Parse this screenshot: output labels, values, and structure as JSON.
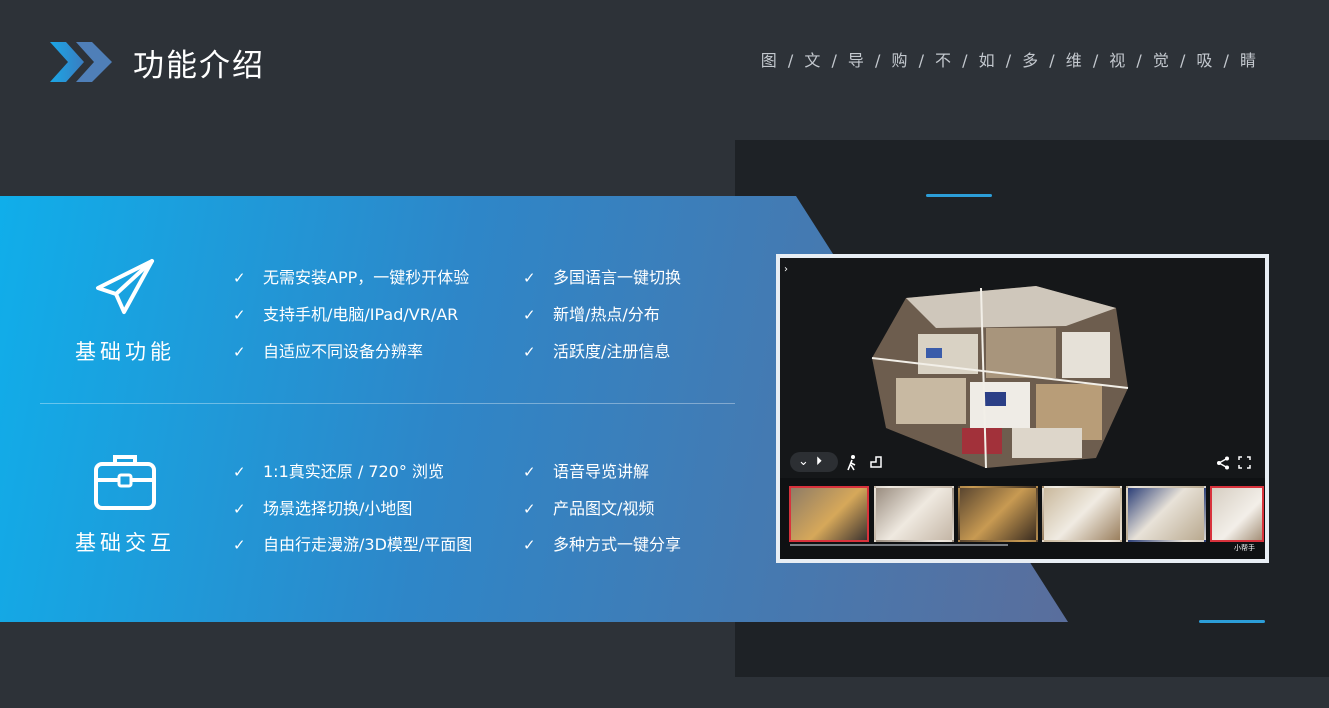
{
  "header": {
    "title": "功能介绍",
    "slogan": "图 / 文 / 导 / 购 / 不 / 如 / 多 / 维 / 视 / 觉 / 吸 / 睛"
  },
  "sections": [
    {
      "label": "基础功能",
      "icon": "paper-plane-icon",
      "features": [
        "无需安装APP，一键秒开体验",
        "支持手机/电脑/IPad/VR/AR",
        "自适应不同设备分辨率",
        "多国语言一键切换",
        "新增/热点/分布",
        "活跃度/注册信息"
      ]
    },
    {
      "label": "基础交互",
      "icon": "briefcase-icon",
      "features": [
        "1:1真实还原 / 720° 浏览",
        "场景选择切换/小地图",
        "自由行走漫游/3D模型/平面图",
        "语音导览讲解",
        "产品图文/视频",
        "多种方式一键分享"
      ]
    }
  ],
  "viewer": {
    "brand_label": "小帮手",
    "icons": [
      "chevron-down-icon",
      "play-icon",
      "walk-icon",
      "floorplan-icon",
      "share-icon",
      "fullscreen-icon"
    ]
  },
  "colors": {
    "background": "#2d3238",
    "panel": "#1e2226",
    "accent": "#2c9ed8",
    "banner_start": "#10aeea",
    "banner_end": "#5a6e9c",
    "active_thumb": "#d8323c"
  }
}
